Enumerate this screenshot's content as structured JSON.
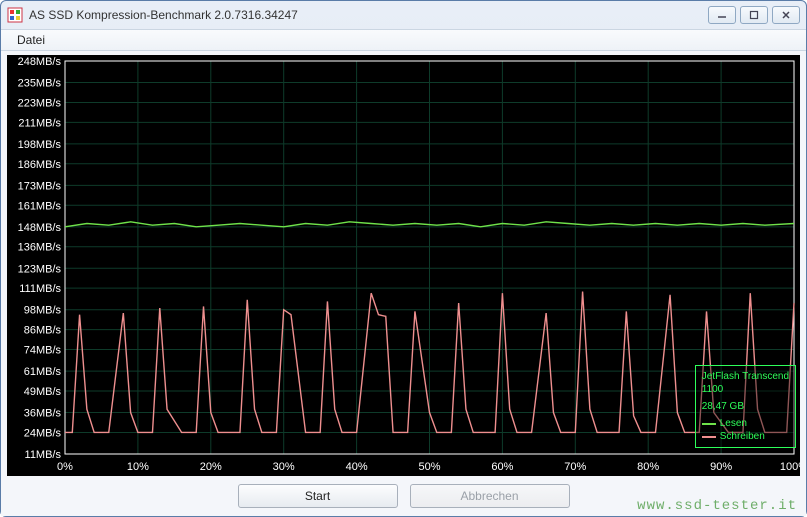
{
  "window": {
    "title": "AS SSD Kompression-Benchmark 2.0.7316.34247"
  },
  "menubar": {
    "file": "Datei"
  },
  "chart_data": {
    "type": "line",
    "xlabel": "",
    "ylabel": "",
    "ylim": [
      11,
      248
    ],
    "xlim": [
      0,
      100
    ],
    "y_ticks": [
      "248MB/s",
      "235MB/s",
      "223MB/s",
      "211MB/s",
      "198MB/s",
      "186MB/s",
      "173MB/s",
      "161MB/s",
      "148MB/s",
      "136MB/s",
      "123MB/s",
      "111MB/s",
      "98MB/s",
      "86MB/s",
      "74MB/s",
      "61MB/s",
      "49MB/s",
      "36MB/s",
      "24MB/s",
      "11MB/s"
    ],
    "x_ticks": [
      "0%",
      "10%",
      "20%",
      "30%",
      "40%",
      "50%",
      "60%",
      "70%",
      "80%",
      "90%",
      "100%"
    ],
    "series": [
      {
        "name": "Lesen",
        "color": "#6fe24a",
        "x": [
          0,
          3,
          6,
          9,
          12,
          15,
          18,
          21,
          24,
          27,
          30,
          33,
          36,
          39,
          42,
          45,
          48,
          51,
          54,
          57,
          60,
          63,
          66,
          69,
          72,
          75,
          78,
          81,
          84,
          87,
          90,
          93,
          96,
          100
        ],
        "values": [
          148,
          150,
          149,
          151,
          149,
          150,
          148,
          149,
          150,
          149,
          148,
          150,
          149,
          151,
          150,
          149,
          150,
          149,
          150,
          148,
          150,
          149,
          151,
          150,
          149,
          150,
          149,
          150,
          149,
          150,
          149,
          150,
          149,
          150
        ]
      },
      {
        "name": "Schreiben",
        "color": "#ef8f8f",
        "x": [
          0,
          1,
          2,
          3,
          4,
          5,
          6,
          8,
          9,
          10,
          11,
          12,
          13,
          14,
          16,
          17,
          18,
          19,
          20,
          21,
          22,
          24,
          25,
          26,
          27,
          28,
          29,
          30,
          31,
          33,
          34,
          35,
          36,
          37,
          38,
          39,
          40,
          42,
          43,
          44,
          45,
          46,
          47,
          48,
          50,
          51,
          52,
          53,
          54,
          55,
          56,
          58,
          59,
          60,
          61,
          62,
          63,
          64,
          66,
          67,
          68,
          69,
          70,
          71,
          72,
          73,
          75,
          76,
          77,
          78,
          79,
          80,
          81,
          83,
          84,
          85,
          86,
          87,
          88,
          89,
          91,
          92,
          93,
          94,
          95,
          96,
          97,
          99,
          100
        ],
        "values": [
          24,
          24,
          95,
          38,
          24,
          24,
          24,
          96,
          36,
          24,
          24,
          24,
          99,
          38,
          24,
          24,
          24,
          100,
          36,
          24,
          24,
          24,
          104,
          38,
          24,
          24,
          24,
          98,
          95,
          24,
          24,
          24,
          103,
          38,
          24,
          24,
          24,
          108,
          95,
          94,
          24,
          24,
          24,
          97,
          36,
          24,
          24,
          24,
          102,
          38,
          24,
          24,
          24,
          108,
          38,
          24,
          24,
          24,
          96,
          36,
          24,
          24,
          24,
          109,
          38,
          24,
          24,
          24,
          97,
          34,
          24,
          24,
          24,
          107,
          36,
          24,
          24,
          24,
          97,
          36,
          24,
          24,
          24,
          108,
          38,
          24,
          24,
          24,
          102
        ]
      }
    ]
  },
  "legend": {
    "device_line1": "JetFlash Transcend",
    "device_line2": "1100",
    "capacity": "28,47 GB",
    "read": "Lesen",
    "write": "Schreiben"
  },
  "buttons": {
    "start": "Start",
    "abort": "Abbrechen"
  },
  "watermark": "www.ssd-tester.it"
}
